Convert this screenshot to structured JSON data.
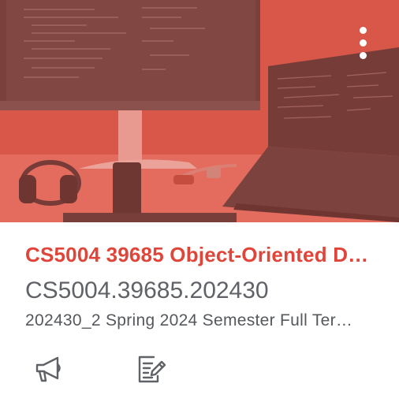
{
  "card": {
    "title": "CS5004 39685 Object-Oriented D…",
    "code": "CS5004.39685.202430",
    "term": "202430_2 Spring 2024 Semester Full Ter…",
    "color": "#e0453a"
  },
  "hero": {
    "overlay_color": "#e74c3c",
    "menu_icon": "kebab-vertical-icon"
  },
  "actions": [
    {
      "icon": "megaphone-icon"
    },
    {
      "icon": "assignment-edit-icon"
    }
  ]
}
